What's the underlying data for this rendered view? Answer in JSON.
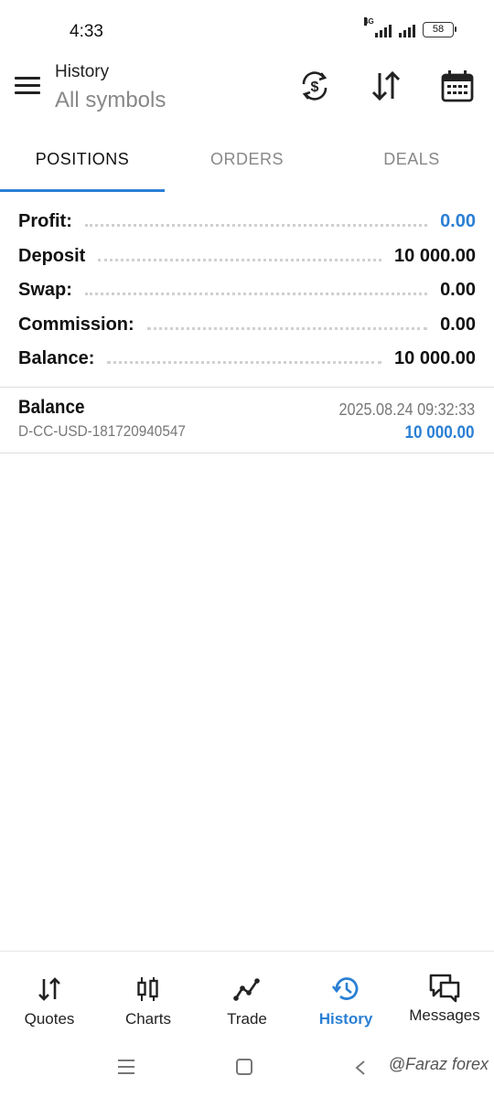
{
  "status_bar": {
    "time": "4:33",
    "network": "4G",
    "battery": "58"
  },
  "header": {
    "title": "History",
    "subtitle": "All symbols",
    "icons": [
      "currency-exchange-icon",
      "sort-icon",
      "calendar-icon"
    ]
  },
  "tabs": [
    {
      "label": "POSITIONS",
      "active": true
    },
    {
      "label": "ORDERS",
      "active": false
    },
    {
      "label": "DEALS",
      "active": false
    }
  ],
  "summary": {
    "rows": [
      {
        "label": "Profit:",
        "value": "0.00"
      },
      {
        "label": "Deposit",
        "value": "10 000.00"
      },
      {
        "label": "Swap:",
        "value": "0.00"
      },
      {
        "label": "Commission:",
        "value": "0.00"
      },
      {
        "label": "Balance:",
        "value": "10 000.00"
      }
    ],
    "profit_color": "#2a7fd4"
  },
  "deals": [
    {
      "title": "Balance",
      "id": "D-CC-USD-181720940547",
      "datetime": "2025.08.24 09:32:33",
      "amount": "10 000.00"
    }
  ],
  "bottom_nav": [
    {
      "label": "Quotes",
      "icon": "quotes-icon",
      "active": false
    },
    {
      "label": "Charts",
      "icon": "charts-icon",
      "active": false
    },
    {
      "label": "Trade",
      "icon": "trade-icon",
      "active": false
    },
    {
      "label": "History",
      "icon": "history-icon",
      "active": true
    },
    {
      "label": "Messages",
      "icon": "messages-icon",
      "active": false
    }
  ],
  "watermark": "@Faraz forex",
  "colors": {
    "accent": "#2a7fd4",
    "text": "#111111",
    "muted": "#888888"
  }
}
